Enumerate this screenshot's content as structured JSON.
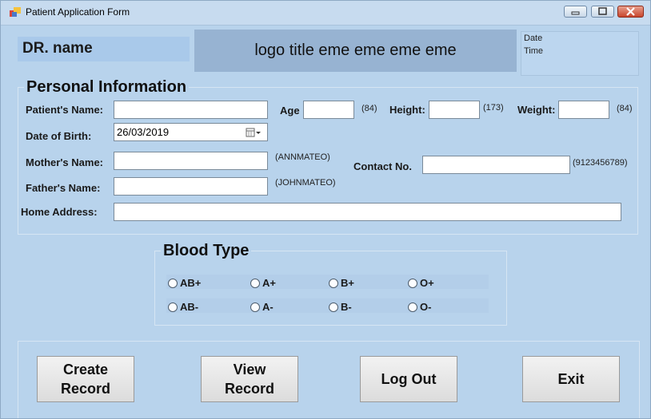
{
  "window": {
    "title": "Patient Application Form"
  },
  "header": {
    "doctor_name": "DR. name",
    "logo_title": "logo title eme eme eme eme",
    "date_label": "Date",
    "time_label": "Time"
  },
  "personal_info": {
    "title": "Personal Information",
    "patient_name_label": "Patient's Name:",
    "patient_name_value": "",
    "age_label": "Age",
    "age_value": "",
    "age_hint": "(84)",
    "height_label": "Height:",
    "height_value": "",
    "height_hint": "(173)",
    "weight_label": "Weight:",
    "weight_value": "",
    "weight_hint": "(84)",
    "dob_label": "Date of Birth:",
    "dob_value": "26/03/2019",
    "mother_label": "Mother's Name:",
    "mother_value": "",
    "mother_hint": "(ANNMATEO)",
    "father_label": "Father's Name:",
    "father_value": "",
    "father_hint": "(JOHNMATEO)",
    "contact_label": "Contact No.",
    "contact_value": "",
    "contact_hint": "(9123456789)",
    "address_label": "Home Address:",
    "address_value": ""
  },
  "blood_type": {
    "title": "Blood Type",
    "options": [
      "AB+",
      "A+",
      "B+",
      "O+",
      "AB-",
      "A-",
      "B-",
      "O-"
    ]
  },
  "actions": {
    "create_line1": "Create",
    "create_line2": "Record",
    "view_line1": "View",
    "view_line2": "Record",
    "logout": "Log Out",
    "exit": "Exit"
  },
  "colors": {
    "form_background": "#b8d3ec",
    "logo_panel": "#97b3d2"
  }
}
